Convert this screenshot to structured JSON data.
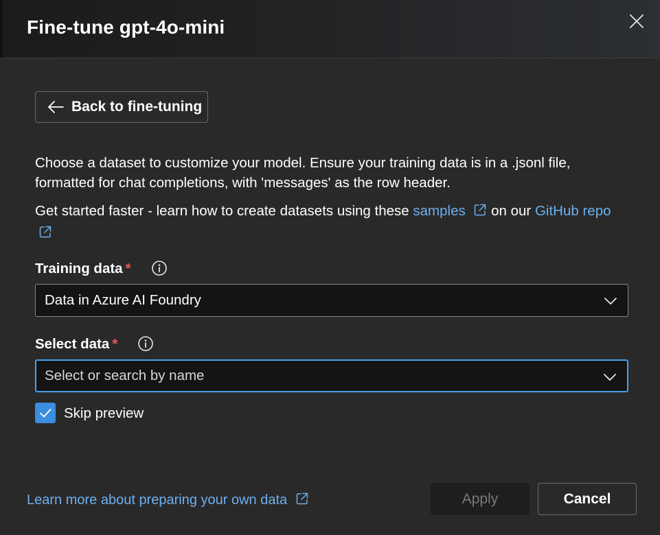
{
  "dialog": {
    "title": "Fine-tune gpt-4o-mini",
    "close_icon": "close-icon"
  },
  "back_button": {
    "label": "Back to fine-tuning",
    "icon": "arrow-left-icon"
  },
  "description": {
    "line1": "Choose a dataset to customize your model. Ensure your training data is in a .jsonl file,",
    "line2": "formatted for chat completions, with 'messages' as the row header.",
    "get_started_prefix": "Get started faster - learn how to create datasets using these ",
    "samples_link": "samples",
    "middle": " on our ",
    "github_link": "GitHub repo"
  },
  "training_data": {
    "label": "Training data",
    "required_mark": "*",
    "value": "Data in Azure AI Foundry"
  },
  "select_data": {
    "label": "Select data",
    "required_mark": "*",
    "placeholder": "Select or search by name"
  },
  "skip_preview": {
    "label": "Skip preview",
    "checked": true
  },
  "footer": {
    "learn_more_link": "Learn more about preparing your own data",
    "apply_label": "Apply",
    "apply_disabled": true,
    "cancel_label": "Cancel"
  },
  "colors": {
    "background": "#292929",
    "link": "#6cb0f0",
    "accent": "#3b8ee0",
    "required": "#e65959"
  }
}
